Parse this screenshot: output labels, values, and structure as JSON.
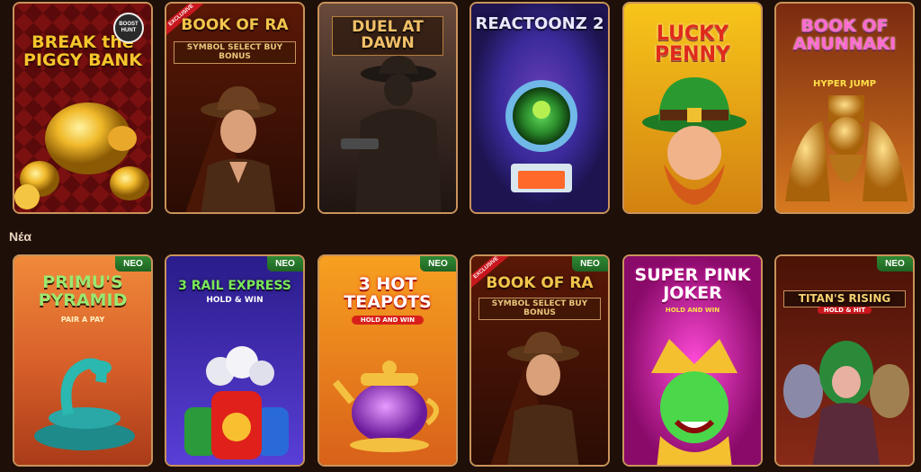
{
  "section_new": {
    "label": "Νέα"
  },
  "top_row": [
    {
      "title": "BREAK the PIGGY BANK",
      "badge": "BOOST HUNT"
    },
    {
      "title": "BOOK OF RA",
      "subtitle": "SYMBOL SELECT BUY BONUS",
      "exclusive": "EXCLUSIVE"
    },
    {
      "title": "DUEL AT DAWN"
    },
    {
      "title": "REACTOONZ 2"
    },
    {
      "title": "LUCKY PENNY"
    },
    {
      "title": "BOOK OF ANUNNAKI",
      "subtitle": "HYPER JUMP"
    }
  ],
  "bottom_row": [
    {
      "title": "PRIMU'S PYRAMID",
      "subtitle": "PAIR A PAY",
      "badge": "NEO"
    },
    {
      "title": "3 RAIL EXPRESS",
      "subtitle": "HOLD & WIN",
      "badge": "NEO"
    },
    {
      "title": "3 HOT TEAPOTS",
      "subtitle": "HOLD AND WIN",
      "badge": "NEO"
    },
    {
      "title": "BOOK OF RA",
      "subtitle": "SYMBOL SELECT BUY BONUS",
      "exclusive": "EXCLUSIVE",
      "badge": "NEO"
    },
    {
      "title": "SUPER PINK JOKER",
      "subtitle": "HOLD AND WIN"
    },
    {
      "title": "TITAN'S RISING",
      "subtitle": "HOLD & HIT",
      "badge": "NEO"
    }
  ]
}
